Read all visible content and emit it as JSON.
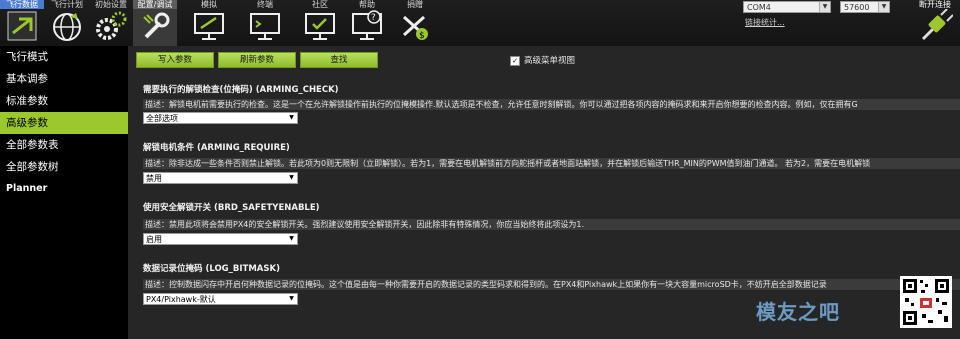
{
  "toolbar": {
    "items": [
      {
        "label": "飞行数据",
        "icon": "flight-data-icon"
      },
      {
        "label": "飞行计划",
        "icon": "globe-icon"
      },
      {
        "label": "初始设置",
        "icon": "gears-icon"
      },
      {
        "label": "配置/调试",
        "icon": "wrench-icon"
      },
      {
        "label": "模拟",
        "icon": "simulation-icon"
      },
      {
        "label": "终端",
        "icon": "terminal-icon"
      },
      {
        "label": "社区",
        "icon": "community-icon"
      },
      {
        "label": "帮助",
        "icon": "help-icon"
      },
      {
        "label": "捐赠",
        "icon": "donate-icon"
      }
    ],
    "port": "COM4",
    "baud": "57600",
    "link_stats": "链接统计...",
    "connect_label": "断开连接"
  },
  "sidebar": {
    "items": [
      {
        "label": "飞行模式"
      },
      {
        "label": "基本调参"
      },
      {
        "label": "标准参数"
      },
      {
        "label": "高级参数"
      },
      {
        "label": "全部参数表"
      },
      {
        "label": "全部参数树"
      },
      {
        "label": "Planner"
      }
    ],
    "active_index": 3
  },
  "actions": {
    "write": "写入参数",
    "refresh": "刷新参数",
    "find": "查找",
    "advanced_view": "高级菜单视图"
  },
  "params": [
    {
      "title": "需要执行的解锁检查(位掩码) (ARMING_CHECK)",
      "desc": "描述：解锁电机前需要执行的检查。这是一个在允许解锁操作前执行的位掩模操作.默认选项是不检查，允许任意时刻解锁。你可以通过把各项内容的掩码求和来开启你想要的检查内容。例如，仅在拥有G",
      "value": "全部选项"
    },
    {
      "title": "解锁电机条件 (ARMING_REQUIRE)",
      "desc": "描述：除非达成一些条件否则禁止解锁。若此项为0则无限制（立即解锁）。若为1，需要在电机解锁前方向舵摇杆或者地面站解锁，并在解锁后输送THR_MIN的PWM值到油门通道。 若为2，需要在电机解锁",
      "value": "禁用"
    },
    {
      "title": "使用安全解锁开关 (BRD_SAFETYENABLE)",
      "desc": "描述：禁用此项将会禁用PX4的安全解锁开关。强烈建议使用安全解锁开关，因此除非有特殊情况，你应当始终将此项设为1.",
      "value": "启用"
    },
    {
      "title": "数据记录位掩码 (LOG_BITMASK)",
      "desc": "描述：控制数据闪存中开启何种数据记录的位掩码。这个值是由每一种你需要开启的数据记录的类型码求和得到的。在PX4和Pixhawk上如果你有一块大容量microSD卡，不妨开启全部数据记录",
      "value": "PX4/Pixhawk-默认"
    }
  ],
  "watermark": "模友之吧",
  "colors": {
    "accent": "#9dc82d",
    "background": "#262626",
    "sidebar": "#000000"
  }
}
